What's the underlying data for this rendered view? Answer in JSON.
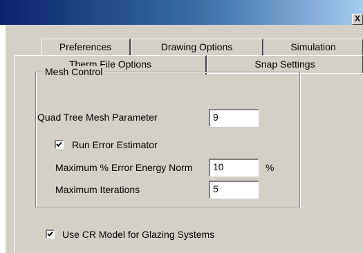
{
  "window": {
    "close_glyph": "X"
  },
  "tabs": {
    "row1": [
      "Preferences",
      "Drawing Options",
      "Simulation"
    ],
    "row2": [
      "Therm File Options",
      "Snap Settings"
    ],
    "active": "Therm File Options"
  },
  "mesh_control": {
    "group_title": "Mesh Control",
    "quad_tree_label": "Quad Tree Mesh Parameter",
    "quad_tree_value": "9",
    "run_error_estimator_label": "Run Error Estimator",
    "run_error_estimator_checked": true,
    "max_error_label": "Maximum % Error Energy Norm",
    "max_error_value": "10",
    "max_error_unit": "%",
    "max_iterations_label": "Maximum Iterations",
    "max_iterations_value": "5"
  },
  "glazing": {
    "cr_model_label": "Use CR Model for Glazing Systems",
    "cr_model_checked": true
  }
}
